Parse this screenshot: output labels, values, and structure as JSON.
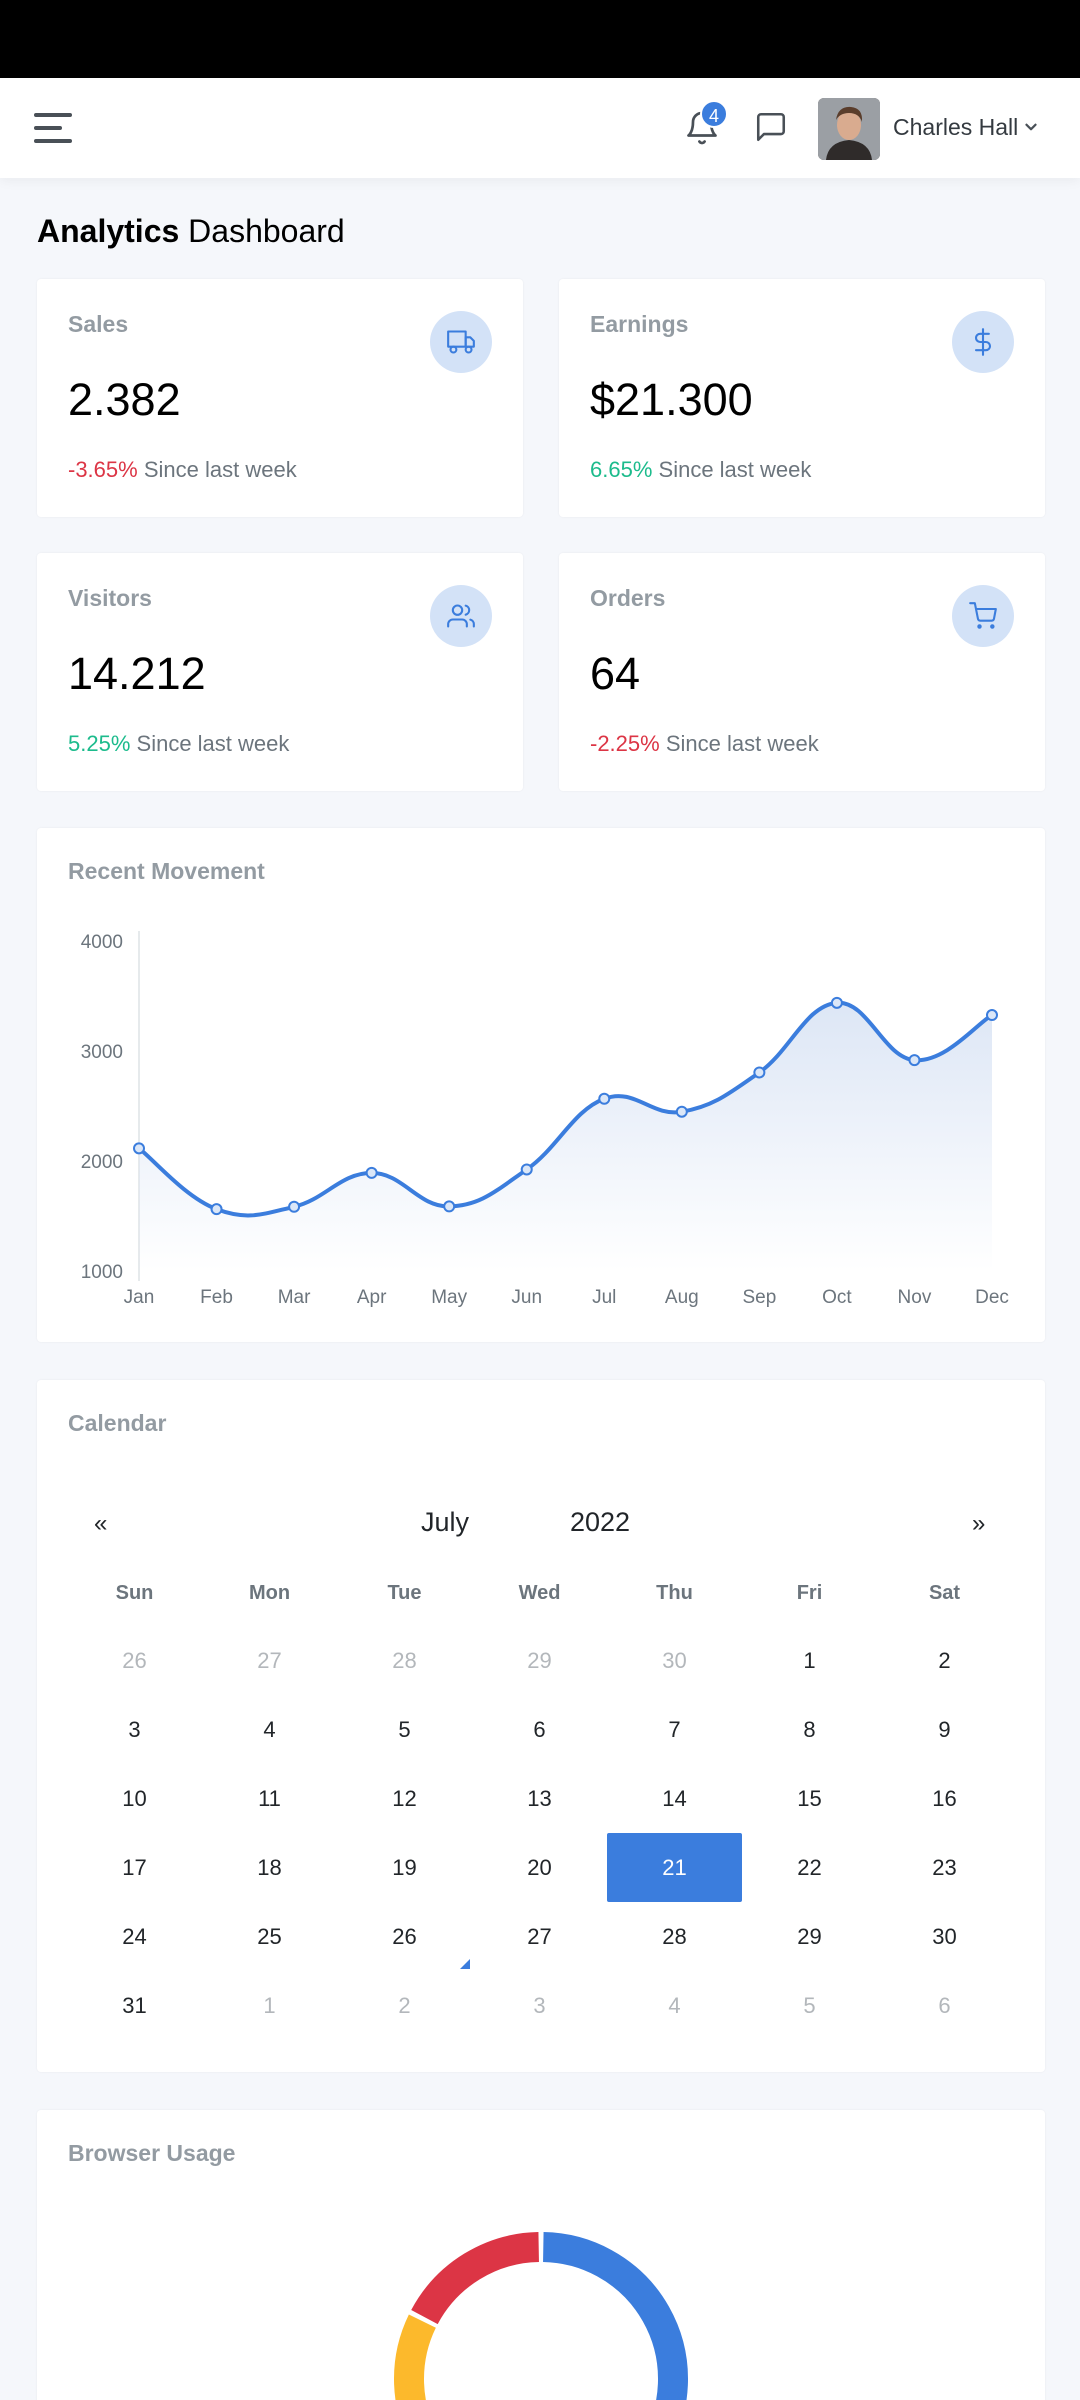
{
  "header": {
    "notification_count": "4",
    "user_name": "Charles Hall"
  },
  "page_title": {
    "strong": "Analytics",
    "rest": "Dashboard"
  },
  "stats": [
    {
      "title": "Sales",
      "value": "2.382",
      "change": "-3.65%",
      "trend": "negative",
      "note": "Since last week",
      "icon": "truck-icon"
    },
    {
      "title": "Earnings",
      "value": "$21.300",
      "change": "6.65%",
      "trend": "positive",
      "note": "Since last week",
      "icon": "dollar-icon"
    },
    {
      "title": "Visitors",
      "value": "14.212",
      "change": "5.25%",
      "trend": "positive",
      "note": "Since last week",
      "icon": "users-icon"
    },
    {
      "title": "Orders",
      "value": "64",
      "change": "-2.25%",
      "trend": "negative",
      "note": "Since last week",
      "icon": "cart-icon"
    }
  ],
  "movement": {
    "title": "Recent Movement"
  },
  "chart_data": {
    "type": "area",
    "x": [
      "Jan",
      "Feb",
      "Mar",
      "Apr",
      "May",
      "Jun",
      "Jul",
      "Aug",
      "Sep",
      "Oct",
      "Nov",
      "Dec"
    ],
    "series": [
      {
        "values": [
          2115,
          1562,
          1584,
          1892,
          1587,
          1923,
          2566,
          2448,
          2805,
          3438,
          2917,
          3327
        ]
      }
    ],
    "ylim": [
      1000,
      4000
    ],
    "yticks": [
      "1000",
      "2000",
      "3000",
      "4000"
    ],
    "grid": false,
    "colors": {
      "line": "#3b7ddd",
      "fill_top": "#dbe5f5"
    }
  },
  "calendar": {
    "title": "Calendar",
    "prev": "«",
    "next": "»",
    "month": "July",
    "year": "2022",
    "weekdays": [
      "Sun",
      "Mon",
      "Tue",
      "Wed",
      "Thu",
      "Fri",
      "Sat"
    ],
    "weeks": [
      [
        {
          "d": "26",
          "m": true
        },
        {
          "d": "27",
          "m": true
        },
        {
          "d": "28",
          "m": true
        },
        {
          "d": "29",
          "m": true
        },
        {
          "d": "30",
          "m": true
        },
        {
          "d": "1"
        },
        {
          "d": "2"
        }
      ],
      [
        {
          "d": "3"
        },
        {
          "d": "4"
        },
        {
          "d": "5"
        },
        {
          "d": "6"
        },
        {
          "d": "7"
        },
        {
          "d": "8"
        },
        {
          "d": "9"
        }
      ],
      [
        {
          "d": "10"
        },
        {
          "d": "11"
        },
        {
          "d": "12"
        },
        {
          "d": "13"
        },
        {
          "d": "14"
        },
        {
          "d": "15"
        },
        {
          "d": "16"
        }
      ],
      [
        {
          "d": "17"
        },
        {
          "d": "18"
        },
        {
          "d": "19"
        },
        {
          "d": "20"
        },
        {
          "d": "21",
          "sel": true
        },
        {
          "d": "22"
        },
        {
          "d": "23"
        }
      ],
      [
        {
          "d": "24"
        },
        {
          "d": "25"
        },
        {
          "d": "26",
          "today": true
        },
        {
          "d": "27"
        },
        {
          "d": "28"
        },
        {
          "d": "29"
        },
        {
          "d": "30"
        }
      ],
      [
        {
          "d": "31"
        },
        {
          "d": "1",
          "m": true
        },
        {
          "d": "2",
          "m": true
        },
        {
          "d": "3",
          "m": true
        },
        {
          "d": "4",
          "m": true
        },
        {
          "d": "5",
          "m": true
        },
        {
          "d": "6",
          "m": true
        }
      ]
    ]
  },
  "browser_usage": {
    "title": "Browser Usage",
    "colors": [
      "#3b7ddd",
      "#dc3545",
      "#fcb92c"
    ]
  }
}
